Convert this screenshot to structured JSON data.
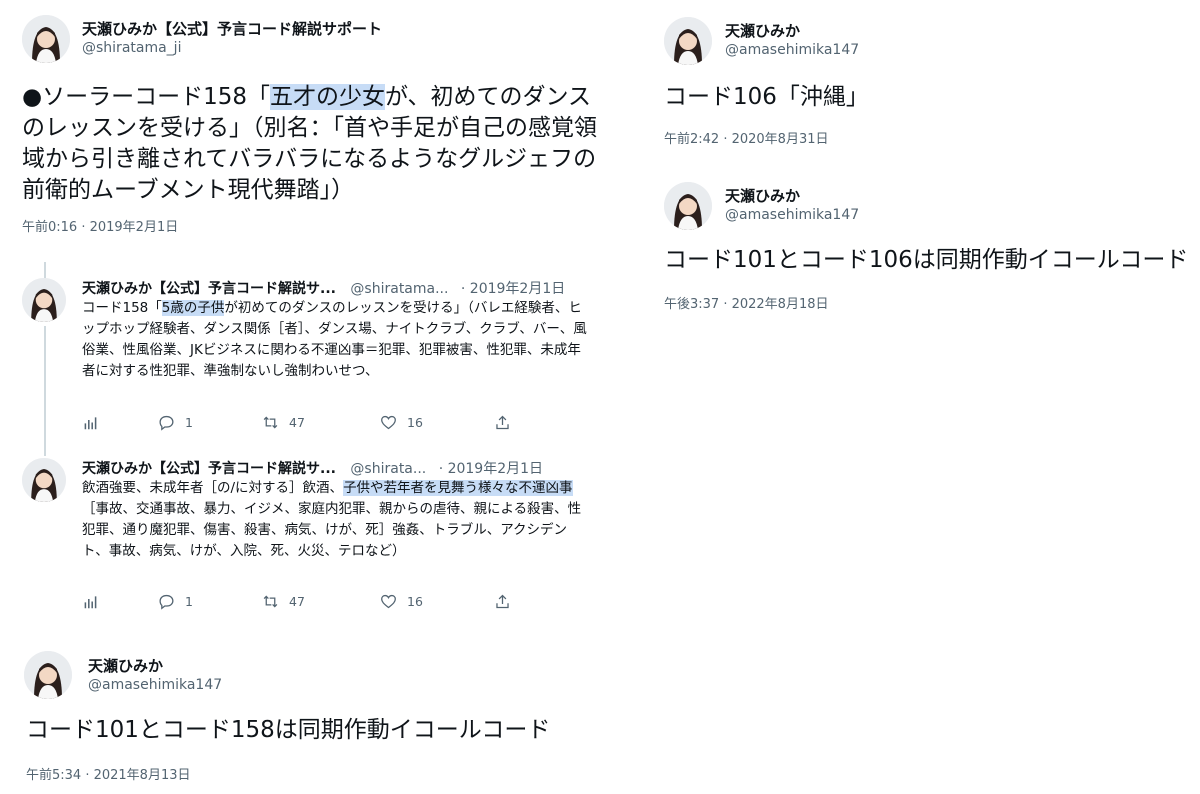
{
  "tweet1": {
    "name": "天瀬ひみか【公式】予言コード解説サポート",
    "handle": "@shiratama_ji",
    "text_pre": "●ソーラーコード158「",
    "text_hl": "五才の少女",
    "text_post": "が、初めてのダンスのレッスンを受ける」（別名：「首や手足が自己の感覚領域から引き離されてバラバラになるようなグルジェフの前衛的ムーブメント現代舞踏」）",
    "time": "午前0:16 · 2019年2月1日"
  },
  "reply1": {
    "name": "天瀬ひみか【公式】予言コード解説サ...",
    "handle": "@shiratama...",
    "date": "· 2019年2月1日",
    "text_pre": "コード158「",
    "text_hl": "5歳の子供",
    "text_post": "が初めてのダンスのレッスンを受ける」（バレエ経験者、ヒップホップ経験者、ダンス関係［者］、ダンス場、ナイトクラブ、クラブ、バー、風俗業、性風俗業、JKビジネスに関わる不運凶事＝犯罪、犯罪被害、性犯罪、未成年者に対する性犯罪、準強制ないし強制わいせつ、",
    "replies": "1",
    "retweets": "47",
    "likes": "16"
  },
  "reply2": {
    "name": "天瀬ひみか【公式】予言コード解説サ...",
    "handle": "@shirata...",
    "date": "· 2019年2月1日",
    "text_pre": "飲酒強要、未成年者［の/に対する］飲酒、",
    "text_hl": "子供や若年者を見舞う様々な不運凶事",
    "text_post": "［事故、交通事故、暴力、イジメ、家庭内犯罪、親からの虐待、親による殺害、性犯罪、通り魔犯罪、傷害、殺害、病気、けが、死］強姦、トラブル、アクシデント、事故、病気、けが、入院、死、火災、テロなど）",
    "replies": "1",
    "retweets": "47",
    "likes": "16"
  },
  "tweet2": {
    "name": "天瀬ひみか",
    "handle": "@amasehimika147",
    "text": "コード101とコード158は同期作動イコールコード",
    "time": "午前5:34 · 2021年8月13日"
  },
  "tweet3": {
    "name": "天瀬ひみか",
    "handle": "@amasehimika147",
    "text": "コード106「沖縄」",
    "time": "午前2:42 · 2020年8月31日"
  },
  "tweet4": {
    "name": "天瀬ひみか",
    "handle": "@amasehimika147",
    "text": "コード101とコード106は同期作動イコールコード",
    "time": "午後3:37 · 2022年8月18日"
  },
  "icons": [
    "avatar",
    "analytics-icon",
    "reply-icon",
    "retweet-icon",
    "like-icon",
    "share-icon"
  ],
  "colors": {
    "highlight": "#c7dcf6",
    "secondary_text": "#536471",
    "thread_line": "#cfd9de"
  }
}
